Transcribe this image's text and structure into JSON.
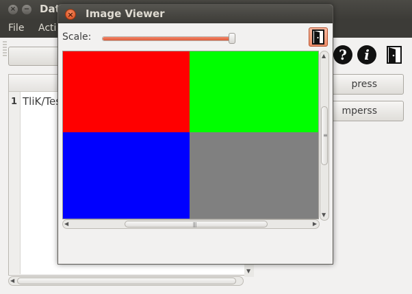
{
  "main_window": {
    "title": "Dat",
    "menu": [
      "File",
      "Acti"
    ],
    "side_buttons": [
      "press",
      "mperss"
    ],
    "table": {
      "row_index": "1",
      "row_text": "TliK/Tes"
    }
  },
  "dialog": {
    "title": "Image Viewer",
    "scale_label": "Scale:",
    "scale_value": 1.0,
    "colors": {
      "top_left": "#ff0000",
      "top_right": "#00ff00",
      "bottom_left": "#0000ff",
      "bottom_right": "#808080"
    },
    "vscroll_thumb_fraction": 0.35,
    "hscroll_thumb_fraction": 0.6
  },
  "icons": {
    "help": "?",
    "info": "i",
    "close_glyph": "×"
  }
}
